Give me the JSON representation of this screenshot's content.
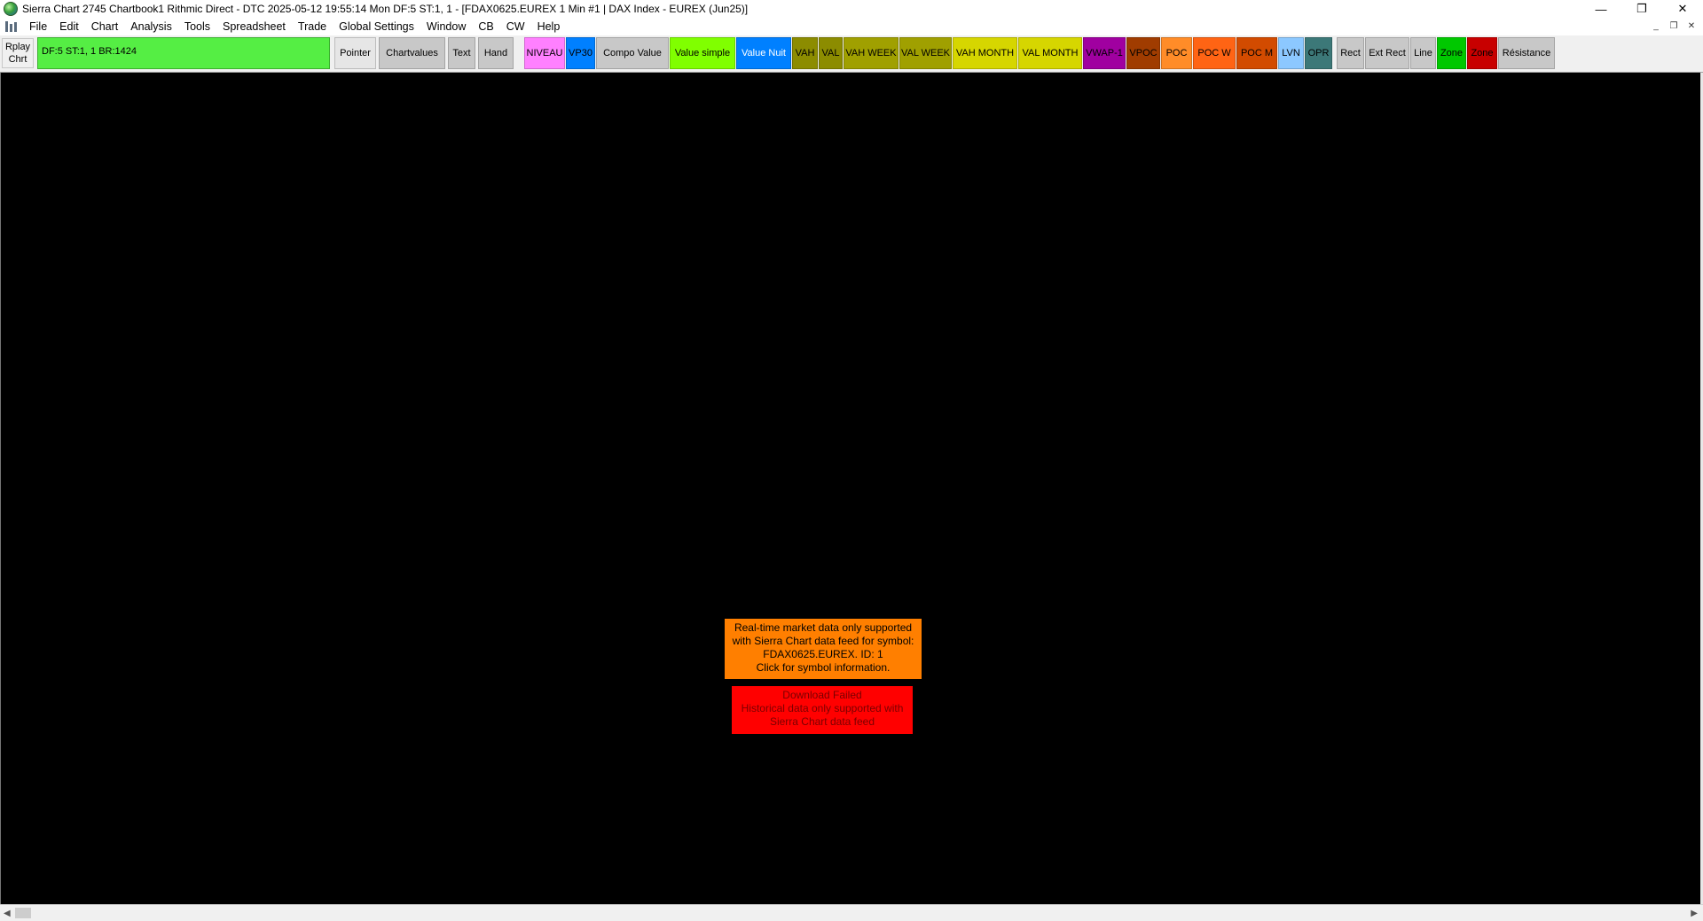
{
  "window": {
    "title": "Sierra Chart 2745 Chartbook1 Rithmic Direct - DTC 2025-05-12  19:55:14 Mon DF:5  ST:1, 1 - [FDAX0625.EUREX  1 Min  #1 | DAX Index - EUREX (Jun25)]",
    "controls": {
      "minimize": "—",
      "restore": "❐",
      "close": "✕"
    }
  },
  "menu": {
    "items": [
      "File",
      "Edit",
      "Chart",
      "Analysis",
      "Tools",
      "Spreadsheet",
      "Trade",
      "Global Settings",
      "Window",
      "CB",
      "CW",
      "Help"
    ],
    "mdi_controls": {
      "minimize": "_",
      "restore": "❐",
      "close": "✕"
    }
  },
  "toolbar": {
    "replay_line1": "Rplay",
    "replay_line2": "Chrt",
    "status_text": "DF:5  ST:1, 1  BR:1424",
    "buttons": [
      {
        "label": "Pointer",
        "bg": "#e6e6e6",
        "fg": "#000000"
      },
      {
        "label": "Chartvalues",
        "bg": "#c8c8c8",
        "fg": "#000000"
      },
      {
        "label": "Text",
        "bg": "#c8c8c8",
        "fg": "#000000"
      },
      {
        "label": "Hand",
        "bg": "#c8c8c8",
        "fg": "#000000"
      },
      {
        "label": "NIVEAU",
        "bg": "#ff80ff",
        "fg": "#000000"
      },
      {
        "label": "VP30",
        "bg": "#0080ff",
        "fg": "#000000"
      },
      {
        "label": "Compo Value",
        "bg": "#c8c8c8",
        "fg": "#000000"
      },
      {
        "label": "Value simple",
        "bg": "#80ff00",
        "fg": "#000000"
      },
      {
        "label": "Value Nuit",
        "bg": "#0080ff",
        "fg": "#ffffff"
      },
      {
        "label": "VAH",
        "bg": "#8c8c00",
        "fg": "#000000"
      },
      {
        "label": "VAL",
        "bg": "#8c8c00",
        "fg": "#000000"
      },
      {
        "label": "VAH WEEK",
        "bg": "#a0a000",
        "fg": "#000000"
      },
      {
        "label": "VAL WEEK",
        "bg": "#a0a000",
        "fg": "#000000"
      },
      {
        "label": "VAH MONTH",
        "bg": "#d6d600",
        "fg": "#000000"
      },
      {
        "label": "VAL MONTH",
        "bg": "#d6d600",
        "fg": "#000000"
      },
      {
        "label": "VWAP-1",
        "bg": "#a000a0",
        "fg": "#000000"
      },
      {
        "label": "VPOC",
        "bg": "#a03c00",
        "fg": "#000000"
      },
      {
        "label": "POC",
        "bg": "#ff8c28",
        "fg": "#000000"
      },
      {
        "label": "POC W",
        "bg": "#ff6414",
        "fg": "#000000"
      },
      {
        "label": "POC M",
        "bg": "#d24b00",
        "fg": "#000000"
      },
      {
        "label": "LVN",
        "bg": "#8cc8ff",
        "fg": "#000000"
      },
      {
        "label": "OPR",
        "bg": "#3c7878",
        "fg": "#000000"
      },
      {
        "label": "Rect",
        "bg": "#c8c8c8",
        "fg": "#000000"
      },
      {
        "label": "Ext Rect",
        "bg": "#c8c8c8",
        "fg": "#000000"
      },
      {
        "label": "Line",
        "bg": "#c8c8c8",
        "fg": "#000000"
      },
      {
        "label": "Zone",
        "bg": "#00c800",
        "fg": "#000000"
      },
      {
        "label": "Zone",
        "bg": "#c80000",
        "fg": "#000000"
      },
      {
        "label": "Résistance",
        "bg": "#c8c8c8",
        "fg": "#000000"
      }
    ]
  },
  "chart": {
    "realtime_message": {
      "line1": "Real-time market data only supported",
      "line2": "with Sierra Chart data feed for symbol:",
      "line3": "FDAX0625.EUREX.  ID: 1",
      "line4": "Click for symbol information."
    },
    "download_message": {
      "line1": "Download Failed",
      "line2": "Historical data only supported with",
      "line3": "Sierra Chart data feed"
    }
  },
  "scrollbar": {
    "left_arrow": "◀",
    "right_arrow": "▶"
  }
}
